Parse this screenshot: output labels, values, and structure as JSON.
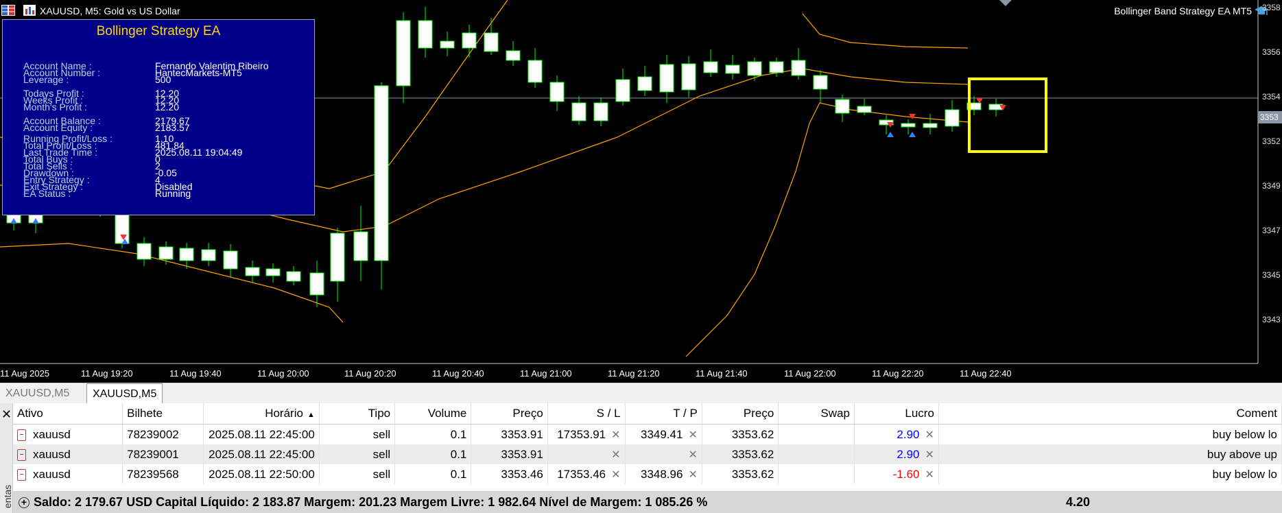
{
  "chart": {
    "title": "XAUUSD, M5:  Gold vs US Dollar",
    "strategy_label": "Bollinger Band Strategy EA MT5",
    "price_ticks": [
      "3358",
      "3356",
      "3354",
      "3352",
      "3349",
      "3347",
      "3345",
      "3343"
    ],
    "current_price": "3353",
    "time_ticks": [
      "11 Aug 2025",
      "11 Aug 19:20",
      "11 Aug 19:40",
      "11 Aug 20:00",
      "11 Aug 20:20",
      "11 Aug 20:40",
      "11 Aug 21:00",
      "11 Aug 21:20",
      "11 Aug 21:40",
      "11 Aug 22:00",
      "11 Aug 22:20",
      "11 Aug 22:40"
    ],
    "colors": {
      "bull": "#00FF00",
      "bear_fill": "#FFFFFF",
      "band": "#FFA500",
      "highlight": "#FFFF00",
      "price_line": "#8a96a8"
    }
  },
  "ea_panel": {
    "title": "Bollinger Strategy EA",
    "rows": [
      {
        "label": "Account Name :",
        "value": "Fernando Valentim Ribeiro"
      },
      {
        "label": "Account Number :",
        "value": "HantecMarkets-MT5"
      },
      {
        "label": "Leverage :",
        "value": "500"
      },
      {
        "label": "Todays Profit :",
        "value": "12.20"
      },
      {
        "label": "Weeks Profit :",
        "value": "12.20"
      },
      {
        "label": "Month's Profit :",
        "value": "12.20"
      },
      {
        "label": "Account Balance :",
        "value": "2179.67"
      },
      {
        "label": "Account Equity :",
        "value": "2183.57"
      },
      {
        "label": "Running Profit/Loss :",
        "value": "1.10"
      },
      {
        "label": "Total Profit/Loss :",
        "value": "481.84"
      },
      {
        "label": "Last Trade Time :",
        "value": "2025.08.11 19:04:49"
      },
      {
        "label": "Total Buys :",
        "value": "0"
      },
      {
        "label": "Total Sells :",
        "value": "2"
      },
      {
        "label": "Drawdown :",
        "value": "-0.05"
      },
      {
        "label": "Entry Strategy :",
        "value": "4"
      },
      {
        "label": "Exit Strategy :",
        "value": "Disabled"
      },
      {
        "label": "EA Status :",
        "value": "Running"
      }
    ]
  },
  "tabs": [
    "XAUUSD,M5",
    "XAUUSD,M5"
  ],
  "toolbox": {
    "side_label": "entas",
    "columns": [
      "Ativo",
      "Bilhete",
      "Horário",
      "Tipo",
      "Volume",
      "Preço",
      "S / L",
      "T / P",
      "Preço",
      "Swap",
      "Lucro",
      "Coment"
    ],
    "rows": [
      {
        "ativo": "xauusd",
        "bilhete": "78239002",
        "horario": "2025.08.11 22:45:00",
        "tipo": "sell",
        "volume": "0.1",
        "preco": "3353.91",
        "sl": "17353.91",
        "tp": "3349.41",
        "preco2": "3353.62",
        "swap": "",
        "lucro": "2.90",
        "comment": "buy below lo"
      },
      {
        "ativo": "xauusd",
        "bilhete": "78239001",
        "horario": "2025.08.11 22:45:00",
        "tipo": "sell",
        "volume": "0.1",
        "preco": "3353.91",
        "sl": "",
        "tp": "",
        "preco2": "3353.62",
        "swap": "",
        "lucro": "2.90",
        "comment": "buy above up"
      },
      {
        "ativo": "xauusd",
        "bilhete": "78239568",
        "horario": "2025.08.11 22:50:00",
        "tipo": "sell",
        "volume": "0.1",
        "preco": "3353.46",
        "sl": "17353.46",
        "tp": "3348.96",
        "preco2": "3353.62",
        "swap": "",
        "lucro": "-1.60",
        "comment": "buy below lo"
      }
    ],
    "summary": "Saldo: 2 179.67 USD  Capital Líquido: 2 183.87  Margem: 201.23  Margem Livre: 1 982.64  Nível de Margem: 1 085.26 %",
    "total": "4.20"
  }
}
